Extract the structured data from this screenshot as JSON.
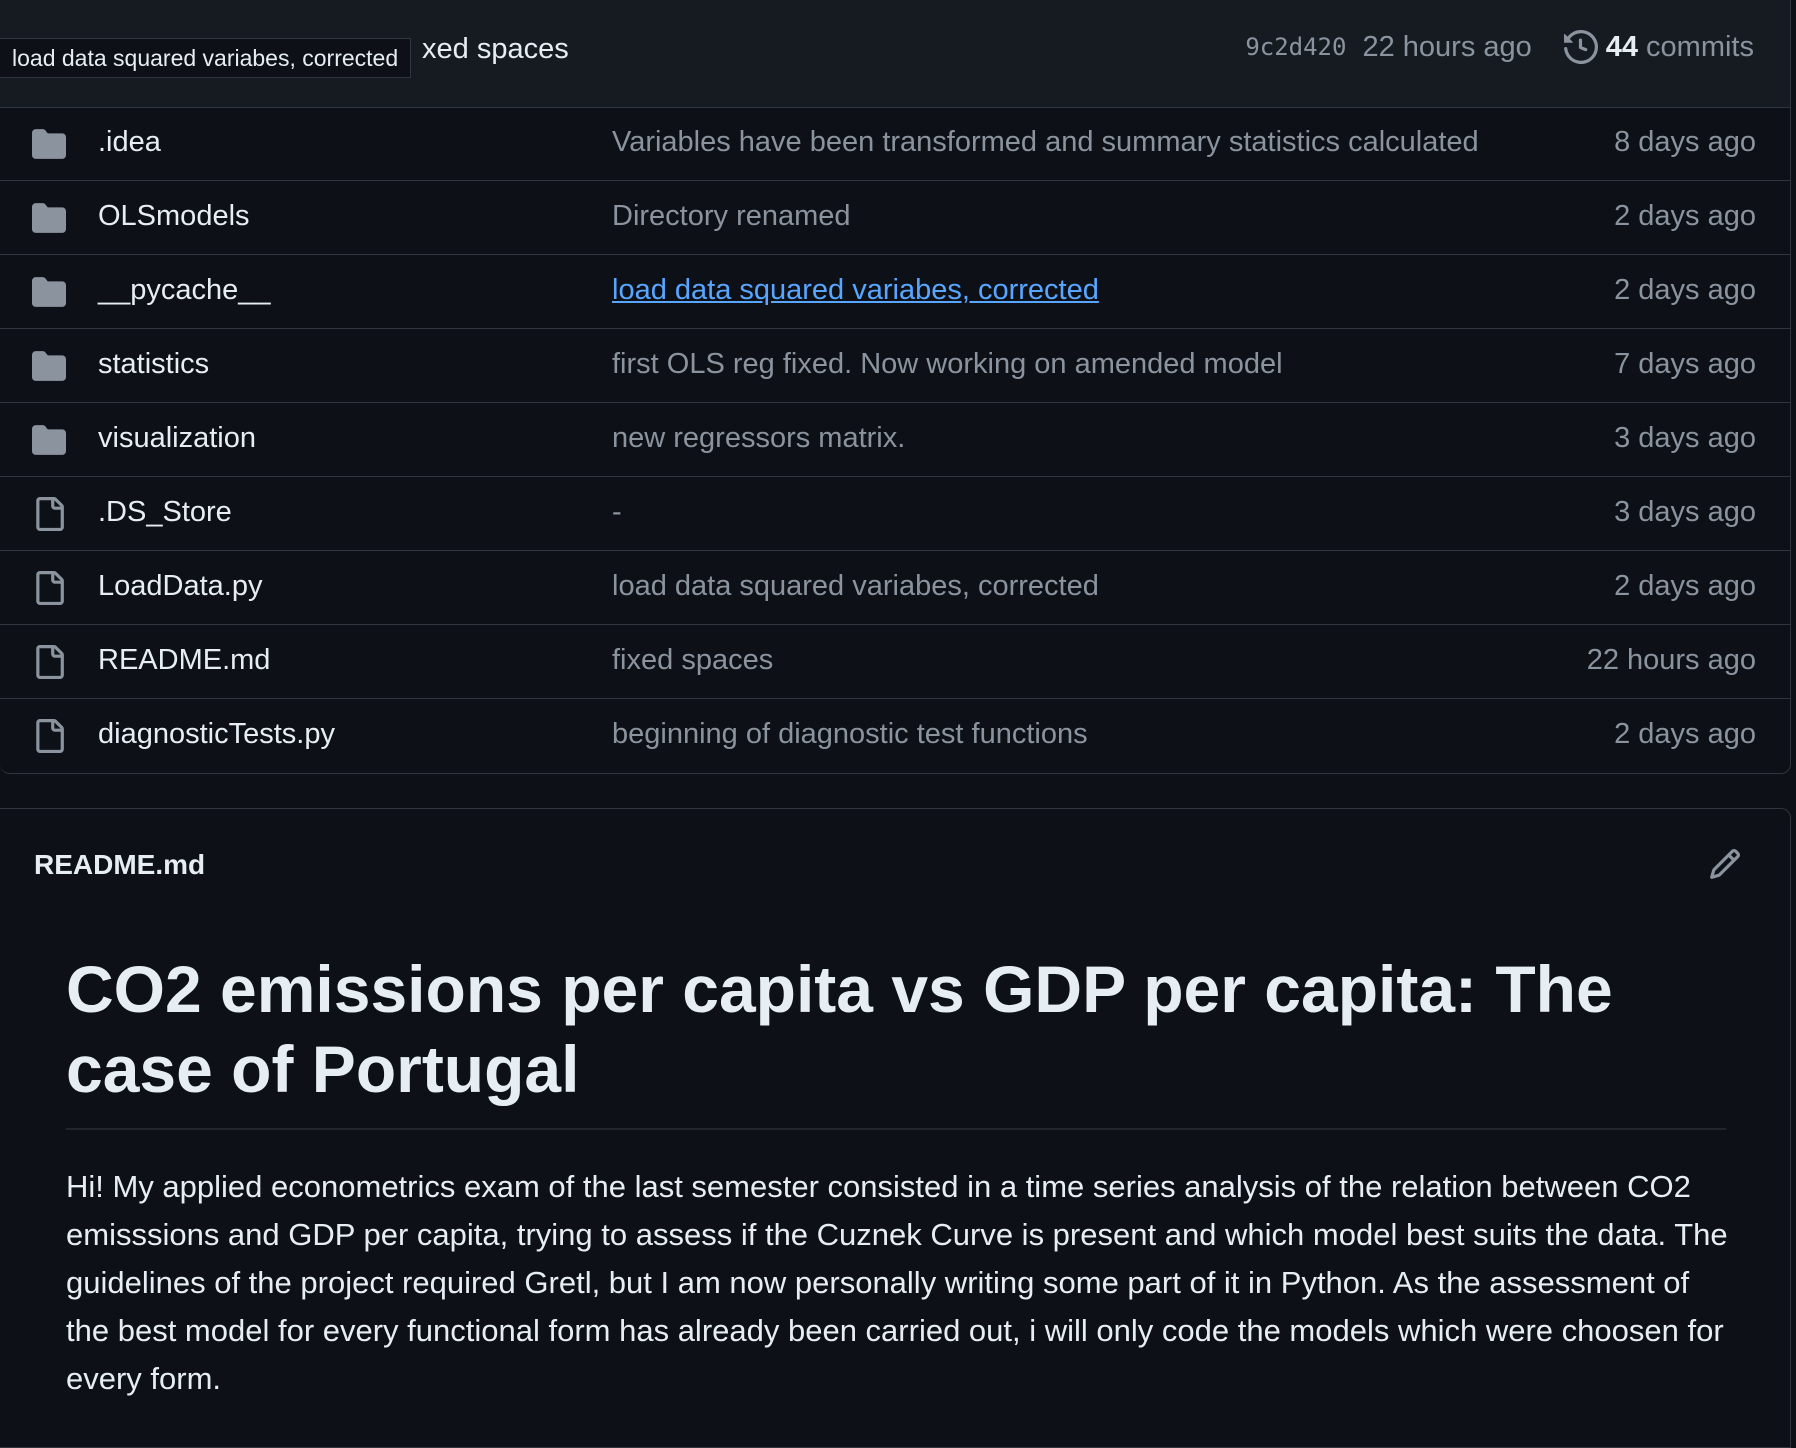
{
  "commit_bar": {
    "tooltip": "load data squared variabes, corrected",
    "message_visible": "xed spaces",
    "sha": "9c2d420",
    "time": "22 hours ago",
    "commits_count": "44",
    "commits_label": "commits"
  },
  "files": [
    {
      "type": "folder",
      "name": ".idea",
      "message": "Variables have been transformed and summary statistics calculated",
      "age": "8 days ago"
    },
    {
      "type": "folder",
      "name": "OLSmodels",
      "message": "Directory renamed",
      "age": "2 days ago"
    },
    {
      "type": "folder",
      "name": "__pycache__",
      "message": "load data squared variabes, corrected",
      "age": "2 days ago"
    },
    {
      "type": "folder",
      "name": "statistics",
      "message": "first OLS reg fixed. Now working on amended model",
      "age": "7 days ago"
    },
    {
      "type": "folder",
      "name": "visualization",
      "message": "new regressors matrix.",
      "age": "3 days ago"
    },
    {
      "type": "file",
      "name": ".DS_Store",
      "message": "-",
      "age": "3 days ago"
    },
    {
      "type": "file",
      "name": "LoadData.py",
      "message": "load data squared variabes, corrected",
      "age": "2 days ago"
    },
    {
      "type": "file",
      "name": "README.md",
      "message": "fixed spaces",
      "age": "22 hours ago"
    },
    {
      "type": "file",
      "name": "diagnosticTests.py",
      "message": "beginning of diagnostic test functions",
      "age": "2 days ago"
    }
  ],
  "readme": {
    "file_label": "README.md",
    "heading": "CO2 emissions per capita vs GDP per capita: The case of Portugal",
    "paragraph": "Hi! My applied econometrics exam of the last semester consisted in a time series analysis of the relation between CO2 emisssions and GDP per capita, trying to assess if the Cuznek Curve is present and which model best suits the data. The guidelines of the project required Gretl, but I am now personally writing some part of it in Python. As the assessment of the best model for every functional form has already been carried out, i will only code the models which were choosen for every form."
  },
  "icons": {
    "folder": "folder-icon",
    "file": "file-icon",
    "history": "history-icon",
    "edit": "pencil-icon"
  },
  "colors": {
    "background": "#0d1117",
    "bar_background": "#161b22",
    "border": "#30363d",
    "text": "#e6edf3",
    "muted": "#8b949e",
    "link": "#58a6ff",
    "folder_icon": "#8b949e"
  }
}
